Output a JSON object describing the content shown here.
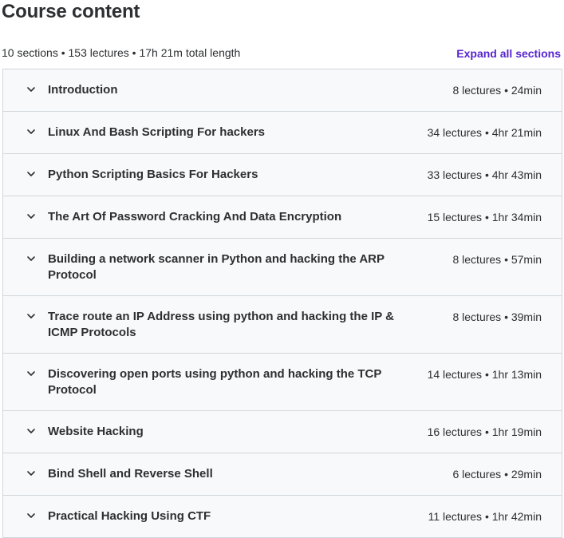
{
  "header": {
    "title": "Course content",
    "summary": "10 sections • 153 lectures • 17h 21m total length",
    "expand_label": "Expand all sections"
  },
  "sections": [
    {
      "title": "Introduction",
      "meta": "8 lectures • 24min"
    },
    {
      "title": "Linux And Bash Scripting For hackers",
      "meta": "34 lectures • 4hr 21min"
    },
    {
      "title": "Python Scripting Basics For Hackers",
      "meta": "33 lectures • 4hr 43min"
    },
    {
      "title": "The Art Of Password Cracking And Data Encryption",
      "meta": "15 lectures • 1hr 34min"
    },
    {
      "title": "Building a network scanner in Python and hacking the ARP Protocol",
      "meta": "8 lectures • 57min"
    },
    {
      "title": "Trace route an IP Address using python and hacking the IP & ICMP Protocols",
      "meta": "8 lectures • 39min"
    },
    {
      "title": "Discovering open ports using python and hacking the TCP Protocol",
      "meta": "14 lectures • 1hr 13min"
    },
    {
      "title": "Website Hacking",
      "meta": "16 lectures • 1hr 19min"
    },
    {
      "title": "Bind Shell and Reverse Shell",
      "meta": "6 lectures • 29min"
    },
    {
      "title": "Practical Hacking Using CTF",
      "meta": "11 lectures • 1hr 42min"
    }
  ],
  "icons": {
    "section_toggle": "chevron-down-icon"
  },
  "colors": {
    "accent": "#5624d0",
    "text": "#2d2f31",
    "section_bg": "#f7f9fa",
    "border": "#d1d7dc"
  }
}
